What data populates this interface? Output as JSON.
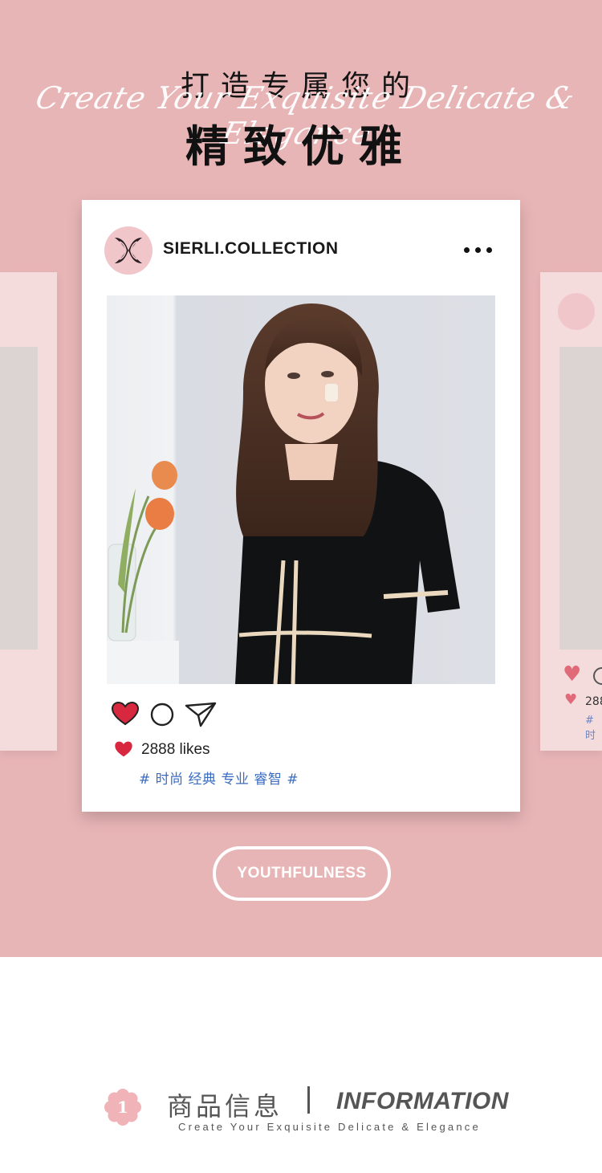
{
  "hero": {
    "script_text": "Create Your Exquisite Delicate & Elegance",
    "title_line1": "打造专属您的",
    "title_line2": "精致优雅",
    "background_color": "#e8b5b6"
  },
  "post": {
    "username": "SIERLI.COLLECTION",
    "more_icon": "more-horizontal-icon",
    "likes_text": "2888 likes",
    "hashtags": "# 时尚 经典 专业 睿智 #",
    "accent_heart_color": "#d8283f",
    "hashtag_color": "#3b6cc1"
  },
  "side_card_right": {
    "likes_text": "288",
    "hashtags": "# 时"
  },
  "badge": {
    "label": "YOUTHFULNESS"
  },
  "info": {
    "number": "1",
    "title_cn": "商品信息",
    "title_en": "INFORMATION",
    "subtitle": "Create Your Exquisite Delicate & Elegance"
  }
}
